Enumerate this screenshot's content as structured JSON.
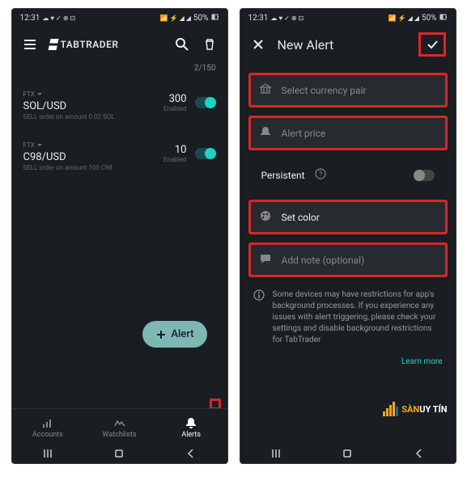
{
  "status": {
    "time": "12:31",
    "battery": "50%",
    "icons_left": "☁ ♥ ✓ ⊕ ⊡",
    "icons_right": "📶 ⚡ ◢ ◢"
  },
  "screen1": {
    "brand": "TABTRADER",
    "counter": "2/150",
    "alerts": [
      {
        "exchange": "FTX",
        "pair": "SOL/USD",
        "desc": "SELL order on amount 0.02 SOL",
        "price": "300",
        "status": "Enabled"
      },
      {
        "exchange": "FTX",
        "pair": "C98/USD",
        "desc": "SELL order on amount 100 C98",
        "price": "10",
        "status": "Enabled"
      }
    ],
    "fab": "Alert",
    "nav": {
      "accounts": "Accounts",
      "watchlists": "Watchlists",
      "alerts": "Alerts"
    }
  },
  "screen2": {
    "title": "New Alert",
    "fields": {
      "currency": "Select currency pair",
      "price": "Alert price",
      "persistent": "Persistent",
      "color": "Set color",
      "note": "Add note (optional)"
    },
    "info": "Some devices may have restrictions for app's background processes. If you experience any issues with alert triggering, please check your settings and disable background restrictions for TabTrader",
    "learn_more": "Learn more"
  },
  "watermark": {
    "a": "SÀN",
    "b": "UY TÍN"
  }
}
